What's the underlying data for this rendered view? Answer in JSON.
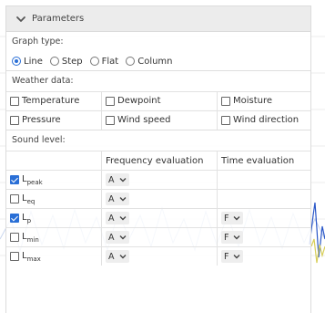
{
  "panel": {
    "title": "Parameters"
  },
  "graph_type": {
    "label": "Graph type:",
    "options": [
      {
        "label": "Line",
        "selected": true
      },
      {
        "label": "Step",
        "selected": false
      },
      {
        "label": "Flat",
        "selected": false
      },
      {
        "label": "Column",
        "selected": false
      }
    ]
  },
  "weather": {
    "label": "Weather data:",
    "items": [
      {
        "label": "Temperature",
        "checked": false
      },
      {
        "label": "Dewpoint",
        "checked": false
      },
      {
        "label": "Moisture",
        "checked": false
      },
      {
        "label": "Pressure",
        "checked": false
      },
      {
        "label": "Wind speed",
        "checked": false
      },
      {
        "label": "Wind direction",
        "checked": false
      }
    ]
  },
  "sound": {
    "label": "Sound level:",
    "col_freq": "Frequency evaluation",
    "col_time": "Time evaluation",
    "rows": [
      {
        "base": "L",
        "sub": "peak",
        "checked": true,
        "freq": "A",
        "time": ""
      },
      {
        "base": "L",
        "sub": "eq",
        "checked": false,
        "freq": "A",
        "time": ""
      },
      {
        "base": "L",
        "sub": "p",
        "checked": true,
        "freq": "A",
        "time": "F"
      },
      {
        "base": "L",
        "sub": "min",
        "checked": false,
        "freq": "A",
        "time": "F"
      },
      {
        "base": "L",
        "sub": "max",
        "checked": false,
        "freq": "A",
        "time": "F"
      }
    ]
  },
  "colors": {
    "accent": "#2a6fd6",
    "header_bg": "#ececec",
    "select_bg": "#eeeeee"
  },
  "icons": {
    "collapse": "chevron-down-icon",
    "select_arrow": "chevron-down-icon"
  }
}
